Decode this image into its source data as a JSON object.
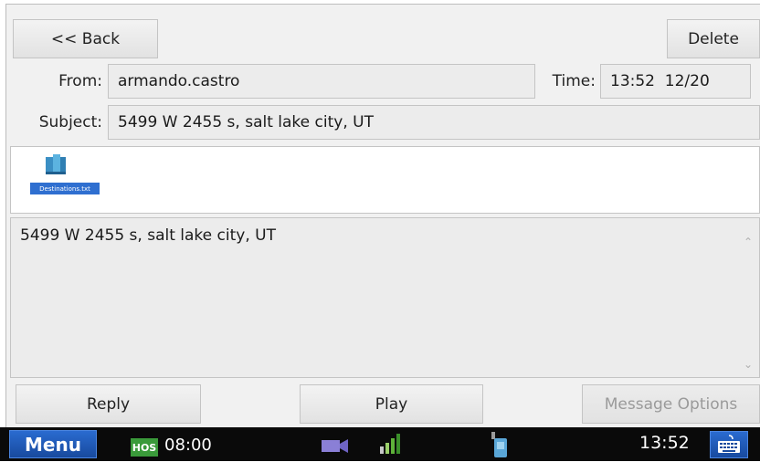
{
  "header": {
    "back_label": "<< Back",
    "delete_label": "Delete"
  },
  "message": {
    "from_label": "From:",
    "from_value": "armando.castro",
    "time_label": "Time:",
    "time_value": "13:52  12/20",
    "subject_label": "Subject:",
    "subject_value": "5499 W 2455 s, salt lake city, UT",
    "attachment_name": "Destinations.txt",
    "body": "5499 W 2455 s, salt lake city, UT"
  },
  "actions": {
    "reply_label": "Reply",
    "play_label": "Play",
    "options_label": "Message Options"
  },
  "taskbar": {
    "menu_label": "Menu",
    "hos_badge": "HOS",
    "hos_time": "08:00",
    "clock": "13:52"
  },
  "colors": {
    "accent": "#2a6bd0",
    "hos_green": "#3a9a3a",
    "taskbar_bg": "#0a0a0a"
  },
  "icons": {
    "attachment": "document-file-icon",
    "camera": "video-camera-icon",
    "signal": "signal-strength-icon",
    "device": "phone-device-icon",
    "keyboard": "keyboard-icon"
  }
}
